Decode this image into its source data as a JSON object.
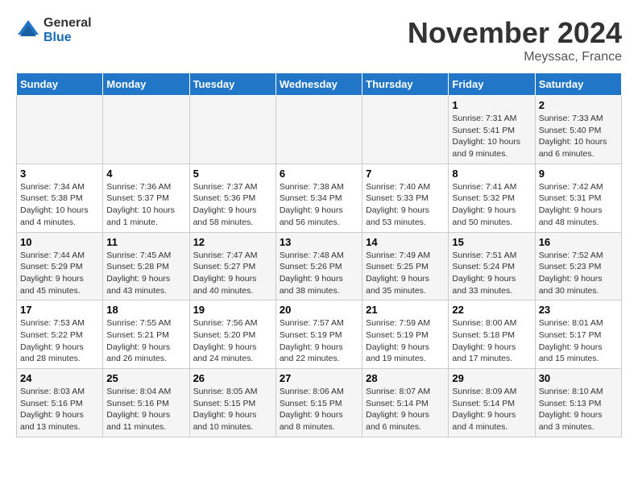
{
  "logo": {
    "general": "General",
    "blue": "Blue"
  },
  "title": "November 2024",
  "location": "Meyssac, France",
  "days_header": [
    "Sunday",
    "Monday",
    "Tuesday",
    "Wednesday",
    "Thursday",
    "Friday",
    "Saturday"
  ],
  "weeks": [
    [
      {
        "day": "",
        "info": ""
      },
      {
        "day": "",
        "info": ""
      },
      {
        "day": "",
        "info": ""
      },
      {
        "day": "",
        "info": ""
      },
      {
        "day": "",
        "info": ""
      },
      {
        "day": "1",
        "info": "Sunrise: 7:31 AM\nSunset: 5:41 PM\nDaylight: 10 hours\nand 9 minutes."
      },
      {
        "day": "2",
        "info": "Sunrise: 7:33 AM\nSunset: 5:40 PM\nDaylight: 10 hours\nand 6 minutes."
      }
    ],
    [
      {
        "day": "3",
        "info": "Sunrise: 7:34 AM\nSunset: 5:38 PM\nDaylight: 10 hours\nand 4 minutes."
      },
      {
        "day": "4",
        "info": "Sunrise: 7:36 AM\nSunset: 5:37 PM\nDaylight: 10 hours\nand 1 minute."
      },
      {
        "day": "5",
        "info": "Sunrise: 7:37 AM\nSunset: 5:36 PM\nDaylight: 9 hours\nand 58 minutes."
      },
      {
        "day": "6",
        "info": "Sunrise: 7:38 AM\nSunset: 5:34 PM\nDaylight: 9 hours\nand 56 minutes."
      },
      {
        "day": "7",
        "info": "Sunrise: 7:40 AM\nSunset: 5:33 PM\nDaylight: 9 hours\nand 53 minutes."
      },
      {
        "day": "8",
        "info": "Sunrise: 7:41 AM\nSunset: 5:32 PM\nDaylight: 9 hours\nand 50 minutes."
      },
      {
        "day": "9",
        "info": "Sunrise: 7:42 AM\nSunset: 5:31 PM\nDaylight: 9 hours\nand 48 minutes."
      }
    ],
    [
      {
        "day": "10",
        "info": "Sunrise: 7:44 AM\nSunset: 5:29 PM\nDaylight: 9 hours\nand 45 minutes."
      },
      {
        "day": "11",
        "info": "Sunrise: 7:45 AM\nSunset: 5:28 PM\nDaylight: 9 hours\nand 43 minutes."
      },
      {
        "day": "12",
        "info": "Sunrise: 7:47 AM\nSunset: 5:27 PM\nDaylight: 9 hours\nand 40 minutes."
      },
      {
        "day": "13",
        "info": "Sunrise: 7:48 AM\nSunset: 5:26 PM\nDaylight: 9 hours\nand 38 minutes."
      },
      {
        "day": "14",
        "info": "Sunrise: 7:49 AM\nSunset: 5:25 PM\nDaylight: 9 hours\nand 35 minutes."
      },
      {
        "day": "15",
        "info": "Sunrise: 7:51 AM\nSunset: 5:24 PM\nDaylight: 9 hours\nand 33 minutes."
      },
      {
        "day": "16",
        "info": "Sunrise: 7:52 AM\nSunset: 5:23 PM\nDaylight: 9 hours\nand 30 minutes."
      }
    ],
    [
      {
        "day": "17",
        "info": "Sunrise: 7:53 AM\nSunset: 5:22 PM\nDaylight: 9 hours\nand 28 minutes."
      },
      {
        "day": "18",
        "info": "Sunrise: 7:55 AM\nSunset: 5:21 PM\nDaylight: 9 hours\nand 26 minutes."
      },
      {
        "day": "19",
        "info": "Sunrise: 7:56 AM\nSunset: 5:20 PM\nDaylight: 9 hours\nand 24 minutes."
      },
      {
        "day": "20",
        "info": "Sunrise: 7:57 AM\nSunset: 5:19 PM\nDaylight: 9 hours\nand 22 minutes."
      },
      {
        "day": "21",
        "info": "Sunrise: 7:59 AM\nSunset: 5:19 PM\nDaylight: 9 hours\nand 19 minutes."
      },
      {
        "day": "22",
        "info": "Sunrise: 8:00 AM\nSunset: 5:18 PM\nDaylight: 9 hours\nand 17 minutes."
      },
      {
        "day": "23",
        "info": "Sunrise: 8:01 AM\nSunset: 5:17 PM\nDaylight: 9 hours\nand 15 minutes."
      }
    ],
    [
      {
        "day": "24",
        "info": "Sunrise: 8:03 AM\nSunset: 5:16 PM\nDaylight: 9 hours\nand 13 minutes."
      },
      {
        "day": "25",
        "info": "Sunrise: 8:04 AM\nSunset: 5:16 PM\nDaylight: 9 hours\nand 11 minutes."
      },
      {
        "day": "26",
        "info": "Sunrise: 8:05 AM\nSunset: 5:15 PM\nDaylight: 9 hours\nand 10 minutes."
      },
      {
        "day": "27",
        "info": "Sunrise: 8:06 AM\nSunset: 5:15 PM\nDaylight: 9 hours\nand 8 minutes."
      },
      {
        "day": "28",
        "info": "Sunrise: 8:07 AM\nSunset: 5:14 PM\nDaylight: 9 hours\nand 6 minutes."
      },
      {
        "day": "29",
        "info": "Sunrise: 8:09 AM\nSunset: 5:14 PM\nDaylight: 9 hours\nand 4 minutes."
      },
      {
        "day": "30",
        "info": "Sunrise: 8:10 AM\nSunset: 5:13 PM\nDaylight: 9 hours\nand 3 minutes."
      }
    ]
  ]
}
